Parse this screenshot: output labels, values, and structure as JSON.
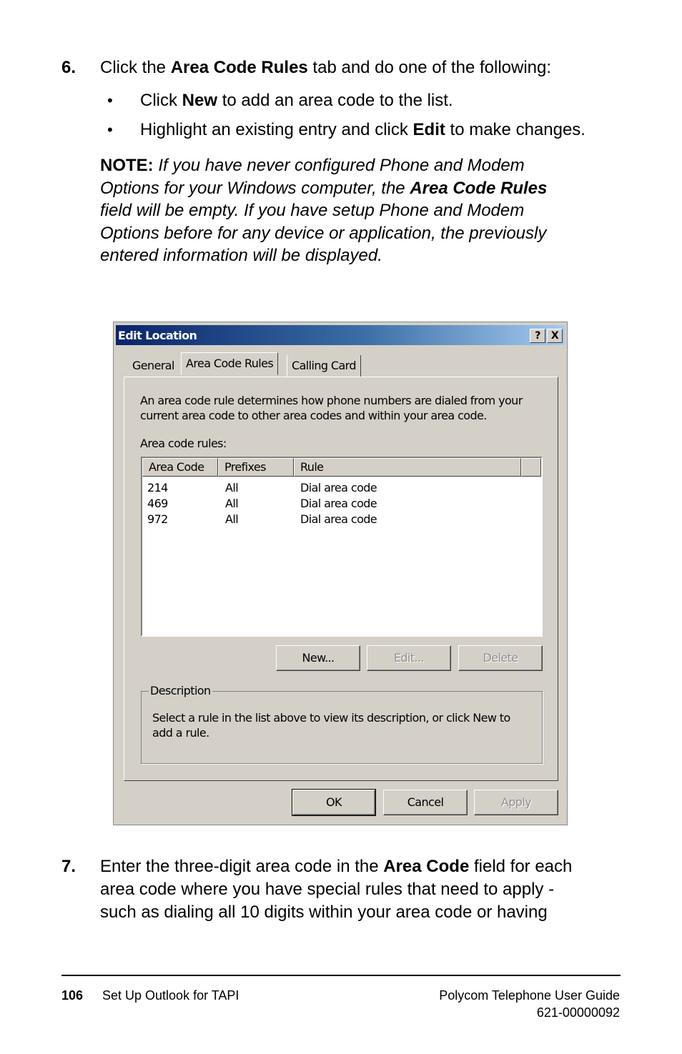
{
  "step6": {
    "number": "6.",
    "text_pre": "Click the ",
    "text_bold": "Area Code Rules",
    "text_post": " tab and do one of the following:",
    "bullets": [
      {
        "pre": "Click ",
        "bold": "New",
        "post": " to add an area code to the list."
      },
      {
        "pre": "Highlight an existing entry and click ",
        "bold": "Edit",
        "post": " to make changes."
      }
    ],
    "note": {
      "label": "NOTE:",
      "line1": " If you have never configured Phone and Modem",
      "line2_pre": "Options for your Windows computer, the ",
      "line2_bold": "Area Code Rules",
      "line3": "field will be empty. If you have setup Phone and Modem",
      "line4": "Options before for any device or application, the previously",
      "line5": "entered information will be displayed."
    }
  },
  "dialog": {
    "title": "Edit Location",
    "help_button": "?",
    "close_button": "X",
    "tabs": [
      {
        "label": "General",
        "active": false
      },
      {
        "label": "Area Code Rules",
        "active": true
      },
      {
        "label": "Calling Card",
        "active": false
      }
    ],
    "intro_line1": "An area code rule determines how phone numbers are dialed from your",
    "intro_line2": "current area code to other area codes and within your area code.",
    "list_label": "Area code rules:",
    "columns": [
      "Area Code",
      "Prefixes",
      "Rule"
    ],
    "rows": [
      {
        "area_code": "214",
        "prefixes": "All",
        "rule": "Dial area code"
      },
      {
        "area_code": "469",
        "prefixes": "All",
        "rule": "Dial area code"
      },
      {
        "area_code": "972",
        "prefixes": "All",
        "rule": "Dial area code"
      }
    ],
    "buttons": {
      "new": "New...",
      "edit": "Edit...",
      "delete": "Delete"
    },
    "description": {
      "label": "Description",
      "line1": "Select a rule in the list above to view its description, or click New to",
      "line2": "add a rule."
    },
    "footer_buttons": {
      "ok": "OK",
      "cancel": "Cancel",
      "apply": "Apply"
    }
  },
  "step7": {
    "number": "7.",
    "line1_pre": "Enter the three-digit area code in the ",
    "line1_bold": "Area Code",
    "line1_post": " field for each",
    "line2": "area code where you have special rules that need to apply -",
    "line3": "such as dialing all 10 digits within your area code or having"
  },
  "footer": {
    "page_number": "106",
    "section": "Set Up Outlook for TAPI",
    "guide_title": "Polycom Telephone User Guide",
    "doc_number": "621-00000092"
  }
}
